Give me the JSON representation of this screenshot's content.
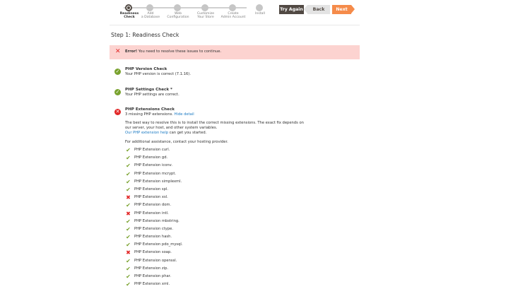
{
  "steps": [
    {
      "label": "Readiness\nCheck",
      "active": true
    },
    {
      "label": "Add\na Database",
      "active": false
    },
    {
      "label": "Web\nConfiguration",
      "active": false
    },
    {
      "label": "Customize\nYour Store",
      "active": false
    },
    {
      "label": "Create\nAdmin Account",
      "active": false
    },
    {
      "label": "Install",
      "active": false
    }
  ],
  "nav": {
    "try_again": "Try Again",
    "back": "Back",
    "next": "Next"
  },
  "page_title": "Step 1: Readiness Check",
  "error": {
    "strong": "Error!",
    "message": " You need to resolve these issues to continue."
  },
  "checks": {
    "php_version": {
      "title": "PHP Version Check",
      "desc": "Your PHP version is correct (7.1.16)."
    },
    "php_settings": {
      "title": "PHP Settings Check *",
      "desc": "Your PHP settings are correct."
    },
    "php_extensions": {
      "title": "PHP Extensions Check",
      "desc": "3 missing PHP extensions.",
      "hide_link": "Hide detail",
      "para1": "The best way to resolve this is to install the correct missing extensions. The exact fix depends on our server, your host, and other system variables.",
      "help_link": "Our PHP extension help",
      "help_suffix": " can get you started.",
      "para2": "For additional assistance, contact your hosting provider."
    }
  },
  "extensions": [
    {
      "label": "PHP Extension curl.",
      "ok": true
    },
    {
      "label": "PHP Extension gd.",
      "ok": true
    },
    {
      "label": "PHP Extension iconv.",
      "ok": true
    },
    {
      "label": "PHP Extension mcrypt.",
      "ok": true
    },
    {
      "label": "PHP Extension simplexml.",
      "ok": true
    },
    {
      "label": "PHP Extension spl.",
      "ok": true
    },
    {
      "label": "PHP Extension xsl.",
      "ok": false
    },
    {
      "label": "PHP Extension dom.",
      "ok": true
    },
    {
      "label": "PHP Extension intl.",
      "ok": false
    },
    {
      "label": "PHP Extension mbstring.",
      "ok": true
    },
    {
      "label": "PHP Extension ctype.",
      "ok": true
    },
    {
      "label": "PHP Extension hash.",
      "ok": true
    },
    {
      "label": "PHP Extension pdo_mysql.",
      "ok": true
    },
    {
      "label": "PHP Extension soap.",
      "ok": false
    },
    {
      "label": "PHP Extension openssl.",
      "ok": true
    },
    {
      "label": "PHP Extension zip.",
      "ok": true
    },
    {
      "label": "PHP Extension phar.",
      "ok": true
    },
    {
      "label": "PHP Extension xml.",
      "ok": true
    }
  ]
}
